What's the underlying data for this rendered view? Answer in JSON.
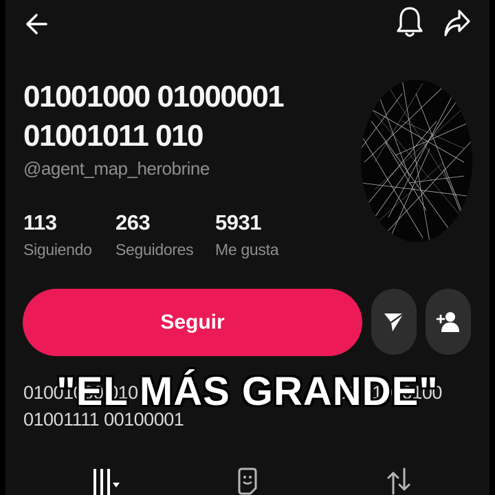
{
  "header": {
    "back_icon": "arrow-left-icon",
    "bell_icon": "bell-icon",
    "share_icon": "share-arrow-icon"
  },
  "profile": {
    "display_name_line1": "01001000 01000001",
    "display_name_line2": "01001011 010",
    "username": "@agent_map_herobrine",
    "avatar_icon": "scratched-black-circle-image"
  },
  "stats": [
    {
      "value": "113",
      "label": "Siguiendo"
    },
    {
      "value": "263",
      "label": "Seguidores"
    },
    {
      "value": "5931",
      "label": "Me gusta"
    }
  ],
  "actions": {
    "follow_label": "Seguir",
    "message_icon": "send-message-icon",
    "add_friend_icon": "add-friend-icon"
  },
  "bio": {
    "line1_left": "01001000 010",
    "line1_right": "01 01000100",
    "line2": "01001111 00100001"
  },
  "overlay": {
    "caption": "\"EL MÁS GRANDE\""
  },
  "tabs": [
    {
      "icon": "grid-videos-icon"
    },
    {
      "icon": "favorites-icon"
    },
    {
      "icon": "repost-icon"
    }
  ],
  "colors": {
    "background": "#121212",
    "accent": "#ec1a56",
    "secondary_button": "#2e2e2e",
    "muted_text": "#8e8e8e"
  }
}
